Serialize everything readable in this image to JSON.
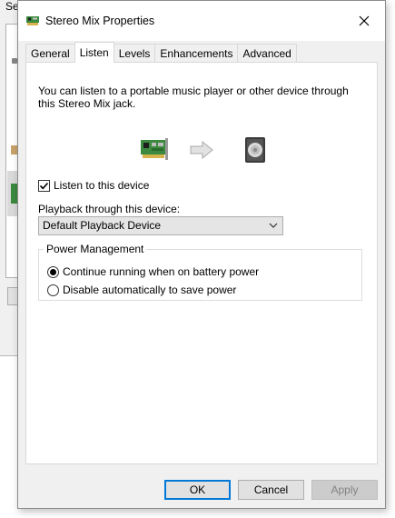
{
  "background_window": {
    "partial_text": "Select a recording device below to modify its settings:"
  },
  "dialog": {
    "title": "Stereo Mix Properties",
    "tabs": [
      {
        "label": "General",
        "active": false
      },
      {
        "label": "Listen",
        "active": true
      },
      {
        "label": "Levels",
        "active": false
      },
      {
        "label": "Enhancements",
        "active": false
      },
      {
        "label": "Advanced",
        "active": false
      }
    ],
    "listen": {
      "description": "You can listen to a portable music player or other device through this Stereo Mix jack.",
      "listen_checkbox": {
        "label": "Listen to this device",
        "checked": true
      },
      "playback_label": "Playback through this device:",
      "playback_select": {
        "value": "Default Playback Device"
      },
      "power_management": {
        "title": "Power Management",
        "options": [
          {
            "label": "Continue running when on battery power",
            "selected": true
          },
          {
            "label": "Disable automatically to save power",
            "selected": false
          }
        ]
      }
    },
    "buttons": {
      "ok": "OK",
      "cancel": "Cancel",
      "apply": "Apply"
    }
  },
  "icons": {
    "title": "sound-card-icon",
    "source": "sound-card-icon",
    "arrow": "arrow-right-icon",
    "target": "speaker-icon",
    "close": "close-icon",
    "check": "checkmark-icon",
    "dropdown": "chevron-down-icon"
  },
  "colors": {
    "accent": "#0078d7",
    "dialog_bg": "#f0f0f0",
    "page_bg": "#ffffff"
  }
}
